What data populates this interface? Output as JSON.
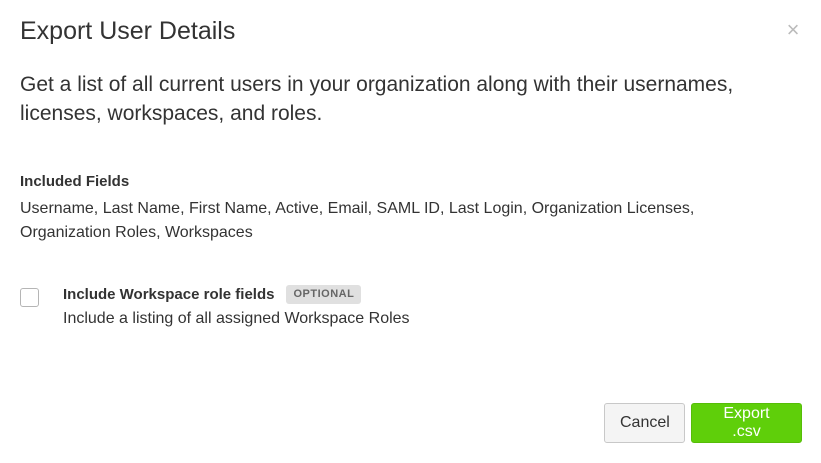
{
  "dialog": {
    "title": "Export User Details",
    "close_glyph": "×",
    "description": "Get a list of all current users in your organization along with their usernames, licenses, workspaces, and roles.",
    "fields_heading": "Included Fields",
    "fields_list": "Username, Last Name, First Name, Active, Email, SAML ID, Last Login, Organization Licenses, Organization Roles, Workspaces",
    "option": {
      "checked": false,
      "title": "Include Workspace role fields",
      "badge": "OPTIONAL",
      "description": "Include a listing of all assigned Workspace Roles"
    },
    "buttons": {
      "cancel_label": "Cancel",
      "export_label": "Export .csv"
    }
  },
  "colors": {
    "primary_button": "#5fcf0a",
    "text": "#333333",
    "badge_bg": "#e0e0e0"
  },
  "icons": {
    "close": "close-icon"
  }
}
